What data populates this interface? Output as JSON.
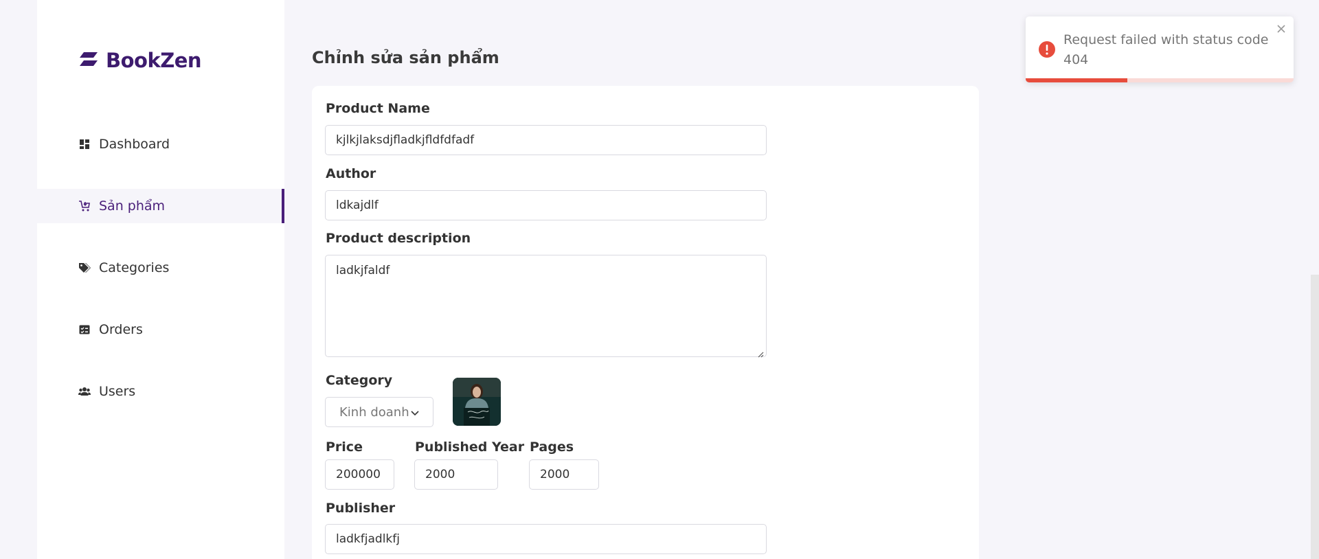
{
  "brand": {
    "name": "BookZen",
    "color": "#3d1b6e"
  },
  "sidebar": {
    "items": [
      {
        "label": "Dashboard",
        "icon": "dashboard-icon",
        "active": false
      },
      {
        "label": "Sản phẩm",
        "icon": "cart-icon",
        "active": true
      },
      {
        "label": "Categories",
        "icon": "tags-icon",
        "active": false
      },
      {
        "label": "Orders",
        "icon": "orders-icon",
        "active": false
      },
      {
        "label": "Users",
        "icon": "users-icon",
        "active": false
      }
    ]
  },
  "page": {
    "title": "Chỉnh sửa sản phẩm"
  },
  "form": {
    "product_name": {
      "label": "Product Name",
      "value": "kjlkjlaksdjfladkjfldfdfadf"
    },
    "author": {
      "label": "Author",
      "value": "ldkajdlf"
    },
    "description": {
      "label": "Product description",
      "value": "ladkjfaldf"
    },
    "category": {
      "label": "Category",
      "value": "Kinh doanh"
    },
    "price": {
      "label": "Price",
      "value": "200000"
    },
    "published_year": {
      "label": "Published Year",
      "value": "2000"
    },
    "pages": {
      "label": "Pages",
      "value": "2000"
    },
    "publisher": {
      "label": "Publisher",
      "value": "ladkfjadlkfj"
    }
  },
  "toast": {
    "message": "Request failed with status code 404",
    "type": "error",
    "color": "#e74c3c",
    "progress": 0.38
  },
  "colors": {
    "accent": "#4a1f7a",
    "background": "#f6f5fa"
  }
}
